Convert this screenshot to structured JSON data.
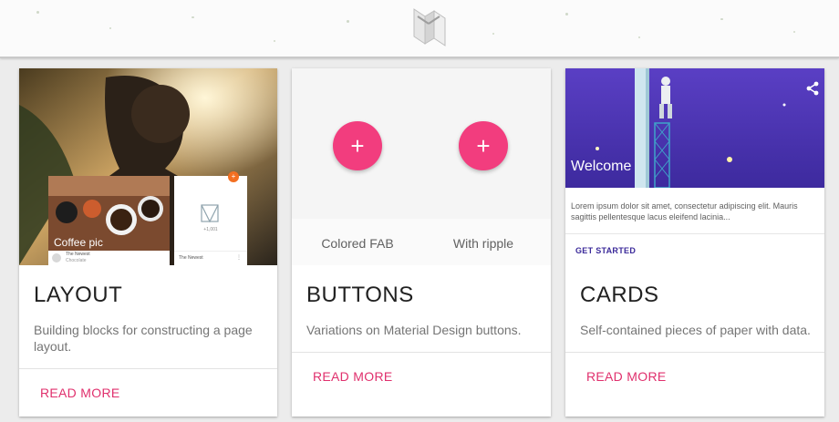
{
  "header": {
    "logo_icon": "mdl-logo-icon"
  },
  "cards": [
    {
      "title": "LAYOUT",
      "description": "Building blocks for constructing a page layout.",
      "action": "READ MORE",
      "media": {
        "photo_caption": "Coffee pic",
        "tile_left_title": "The Newest",
        "tile_left_sub": "Chocolate",
        "tile_right_title": "The Newest",
        "tile_right_count": "+1,001"
      }
    },
    {
      "title": "BUTTONS",
      "description": "Variations on Material Design buttons.",
      "action": "READ MORE",
      "media": {
        "fab_symbol": "+",
        "fab_left_label": "Colored FAB",
        "fab_right_label": "With ripple"
      }
    },
    {
      "title": "CARDS",
      "description": "Self-contained pieces of paper with data.",
      "action": "READ MORE",
      "media": {
        "welcome": "Welcome",
        "lorem": "Lorem ipsum dolor sit amet, consectetur adipiscing elit. Mauris sagittis pellentesque lacus eleifend lacinia...",
        "get_started": "GET STARTED",
        "share_icon": "share-icon"
      }
    }
  ],
  "colors": {
    "accent": "#e0306d",
    "fab": "#f23d7e",
    "dark_purple": "#3b2a9a"
  }
}
